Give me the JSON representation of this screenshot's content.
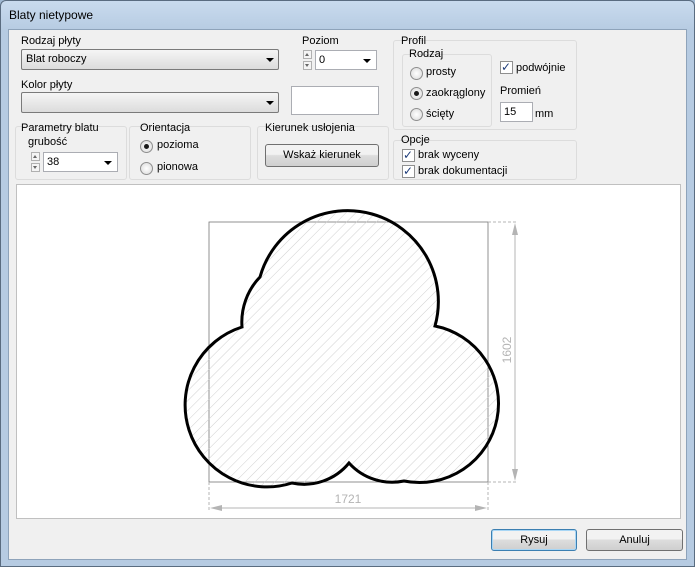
{
  "window": {
    "title": "Blaty nietypowe"
  },
  "rodzaj_plyty": {
    "label": "Rodzaj płyty",
    "value": "Blat roboczy"
  },
  "poziom": {
    "label": "Poziom",
    "value": "0"
  },
  "kolor_plyty": {
    "label": "Kolor płyty",
    "value": ""
  },
  "parametry": {
    "label": "Parametry blatu",
    "grubosc_label": "grubość",
    "grubosc_value": "38"
  },
  "orientacja": {
    "label": "Orientacja",
    "options": [
      "pozioma",
      "pionowa"
    ],
    "selected": "pozioma"
  },
  "kierunek": {
    "label": "Kierunek usłojenia",
    "button": "Wskaż kierunek"
  },
  "profil": {
    "label": "Profil",
    "rodzaj_label": "Rodzaj",
    "options": [
      "prosty",
      "zaokrąglony",
      "ścięty"
    ],
    "selected": "zaokrąglony",
    "podwojnie_label": "podwójnie",
    "podwojnie_checked": true,
    "promien_label": "Promień",
    "promien_value": "15",
    "promien_unit": "mm"
  },
  "opcje": {
    "label": "Opcje",
    "items": [
      {
        "label": "brak wyceny",
        "checked": true
      },
      {
        "label": "brak dokumentacji",
        "checked": true
      }
    ]
  },
  "drawing": {
    "width_dim": "1721",
    "height_dim": "1602"
  },
  "buttons": {
    "draw": "Rysuj",
    "cancel": "Anuluj"
  },
  "colors": {
    "client_bg": "#f0f0f0",
    "dimension_line": "#b4b4b4",
    "shape_outline": "#000000"
  }
}
